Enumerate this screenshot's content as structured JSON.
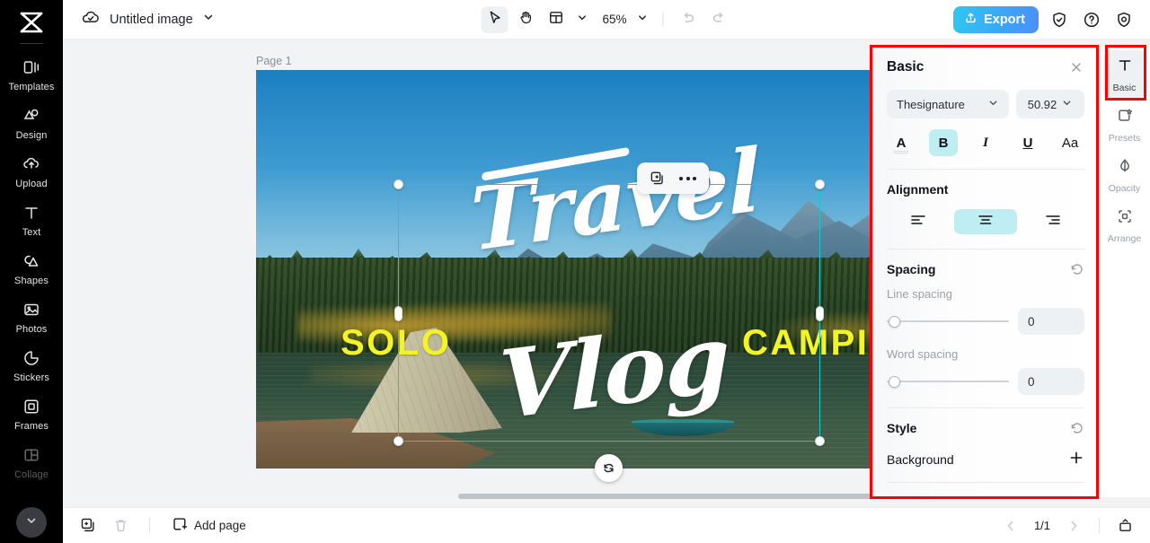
{
  "colors": {
    "accent_export_from": "#2fc7f2",
    "accent_export_to": "#4b8ffb",
    "selection": "#1fc5c9",
    "active_chip": "#bfeef2",
    "annotation": "#ff0000",
    "overlay_text_yellow": "#f2f424",
    "rail_bg": "#000000"
  },
  "left_rail": {
    "logo_name": "capcut-logo-icon",
    "items": [
      {
        "label": "Templates",
        "icon": "templates-icon",
        "dim": false
      },
      {
        "label": "Design",
        "icon": "design-icon",
        "dim": false
      },
      {
        "label": "Upload",
        "icon": "upload-icon",
        "dim": false
      },
      {
        "label": "Text",
        "icon": "text-icon",
        "dim": false
      },
      {
        "label": "Shapes",
        "icon": "shapes-icon",
        "dim": false
      },
      {
        "label": "Photos",
        "icon": "photos-icon",
        "dim": false
      },
      {
        "label": "Stickers",
        "icon": "stickers-icon",
        "dim": false
      },
      {
        "label": "Frames",
        "icon": "frames-icon",
        "dim": false
      },
      {
        "label": "Collage",
        "icon": "collage-icon",
        "dim": true
      }
    ],
    "collapse_icon": "chevron-down-icon"
  },
  "topbar": {
    "cloud_icon": "cloud-saved-icon",
    "doc_title": "Untitled image",
    "title_caret": "chevron-down-icon",
    "tools": [
      {
        "name": "select-tool",
        "icon": "cursor-arrow-icon",
        "active": true
      },
      {
        "name": "hand-tool",
        "icon": "hand-icon",
        "active": false
      },
      {
        "name": "layout-tool",
        "icon": "layout-grid-icon",
        "active": false
      }
    ],
    "layout_caret": "chevron-down-icon",
    "zoom_value": "65%",
    "zoom_caret": "chevron-down-icon",
    "undo_icon": "undo-arrow-icon",
    "redo_icon": "redo-arrow-icon",
    "export_label": "Export",
    "export_icon": "upload-share-icon",
    "shield_icon": "shield-check-icon",
    "help_icon": "question-circle-icon",
    "settings_icon": "gear-icon"
  },
  "workspace": {
    "page_label": "Page 1",
    "design": {
      "yellow_left": "SOLO",
      "yellow_right": "CAMPI",
      "script_line1": "Travel",
      "script_line2": "Vlog"
    },
    "float_toolbar": {
      "duplicate_icon": "duplicate-icon",
      "more_icon": "more-horizontal-icon"
    },
    "rotate_icon": "rotate-handle-icon"
  },
  "properties": {
    "title": "Basic",
    "close_icon": "close-icon",
    "font_family": "Thesignature",
    "font_family_caret": "chevron-down-icon",
    "font_size": "50.92",
    "font_size_caret": "chevron-down-icon",
    "style_buttons": [
      {
        "name": "text-color-button",
        "glyph": "A",
        "active": false
      },
      {
        "name": "bold-button",
        "glyph": "B",
        "active": true
      },
      {
        "name": "italic-button",
        "glyph": "I",
        "active": false
      },
      {
        "name": "underline-button",
        "glyph": "U",
        "active": false
      },
      {
        "name": "text-case-button",
        "glyph": "Aa",
        "active": false
      }
    ],
    "alignment_title": "Alignment",
    "alignment_options": [
      {
        "name": "align-left-icon",
        "active": false
      },
      {
        "name": "align-center-icon",
        "active": true
      },
      {
        "name": "align-right-icon",
        "active": false
      }
    ],
    "spacing_title": "Spacing",
    "spacing_reset_icon": "reset-icon",
    "line_spacing_label": "Line spacing",
    "line_spacing_value": "0",
    "word_spacing_label": "Word spacing",
    "word_spacing_value": "0",
    "style_title": "Style",
    "style_reset_icon": "reset-icon",
    "background_label": "Background",
    "background_add_icon": "plus-icon"
  },
  "right_rail": {
    "items": [
      {
        "label": "Basic",
        "icon": "text-basic-icon",
        "selected": true
      },
      {
        "label": "Presets",
        "icon": "presets-icon",
        "selected": false
      },
      {
        "label": "Opacity",
        "icon": "opacity-icon",
        "selected": false
      },
      {
        "label": "Arrange",
        "icon": "arrange-icon",
        "selected": false
      }
    ]
  },
  "bottombar": {
    "duplicate_page_icon": "duplicate-page-icon",
    "delete_page_icon": "trash-icon",
    "add_page_label": "Add page",
    "add_page_icon": "add-page-icon",
    "prev_icon": "chevron-left-icon",
    "page_indicator": "1/1",
    "next_icon": "chevron-right-icon",
    "present_icon": "present-icon"
  }
}
